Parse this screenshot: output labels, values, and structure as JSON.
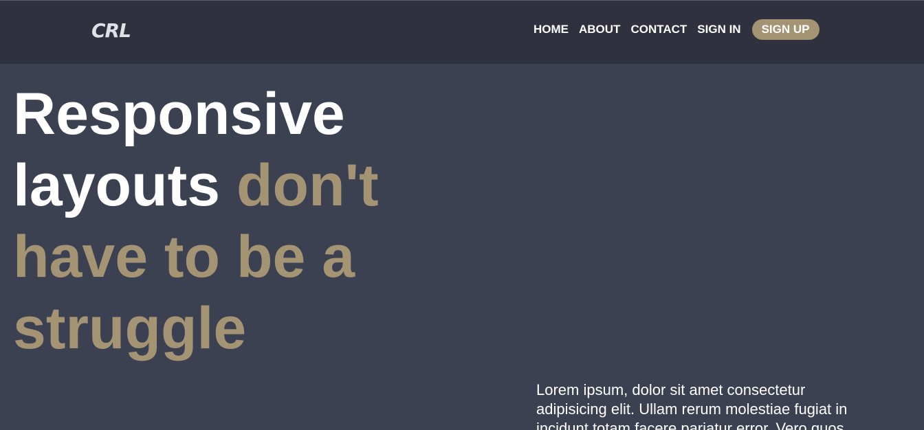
{
  "colors": {
    "header_bg": "#2f323e",
    "page_bg": "#3c4151",
    "accent": "#a49474",
    "text": "#ffffff"
  },
  "header": {
    "logo": "CRL",
    "nav": {
      "home": "HOME",
      "about": "ABOUT",
      "contact": "CONTACT",
      "sign_in": "SIGN IN",
      "sign_up": "SIGN UP"
    }
  },
  "hero": {
    "title_white": "Responsive layouts",
    "title_accent": "don't have to be a struggle"
  },
  "intro": {
    "text": "Lorem ipsum, dolor sit amet consectetur adipisicing elit. Ullam rerum molestiae fugiat in incidunt totam facere pariatur error. Vero quos"
  }
}
